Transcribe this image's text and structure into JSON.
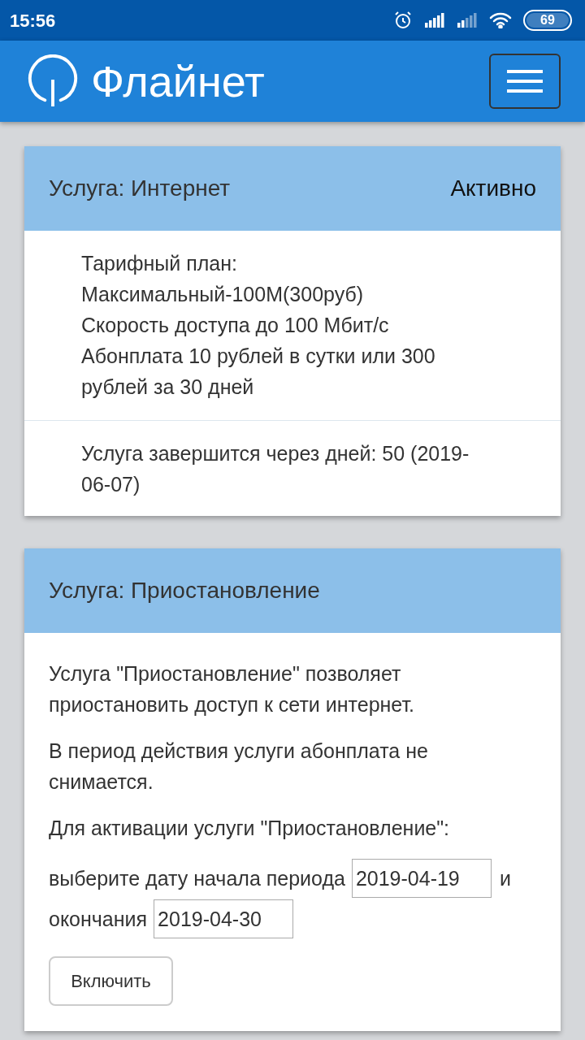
{
  "status_bar": {
    "time": "15:56",
    "battery": "69"
  },
  "header": {
    "brand": "Флайнет"
  },
  "internet_card": {
    "title": "Услуга: Интернет",
    "status": "Активно",
    "plan_lines": [
      "Тарифный план:",
      "Максимальный-100М(300руб)",
      "Скорость доступа до 100 Мбит/с",
      "Абонплата 10 рублей в сутки или 300 рублей за 30 дней"
    ],
    "expiry": "Услуга завершится через дней: 50 (2019-06-07)"
  },
  "suspend_card": {
    "title": "Услуга: Приостановление",
    "paragraphs": [
      "Услуга \"Приостановление\" позволяет приостановить доступ к сети интернет.",
      "В период действия услуги абонплата не снимается.",
      "Для активации услуги \"Приостановление\":"
    ],
    "form": {
      "start_label": "выберите дату начала периода",
      "start_date": "2019-04-19",
      "joiner": "и",
      "end_label": "окончания",
      "end_date": "2019-04-30"
    },
    "button": "Включить"
  }
}
